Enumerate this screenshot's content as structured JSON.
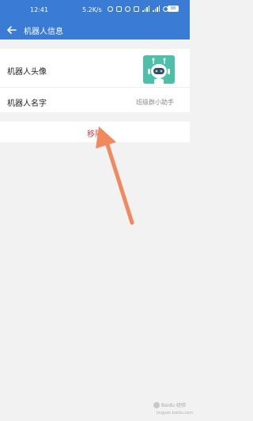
{
  "status_bar": {
    "time": "12:41",
    "network_speed": "5.2K/s",
    "battery": "88"
  },
  "app_bar": {
    "title": "机器人信息",
    "back_icon": "arrow-left-icon"
  },
  "profile": {
    "avatar_label": "机器人头像",
    "avatar_icon": "robot-icon",
    "name_label": "机器人名字",
    "name_value": "班级群小助手"
  },
  "actions": {
    "remove_label": "移除"
  },
  "annotation": {
    "arrow_color": "#f08a5d"
  },
  "watermark": {
    "text": "Baidu 经验",
    "url": "jingyan.baidu.com"
  },
  "colors": {
    "primary": "#3a7bd5",
    "danger": "#d0474f",
    "avatar_bg": "#4cc0a8"
  }
}
